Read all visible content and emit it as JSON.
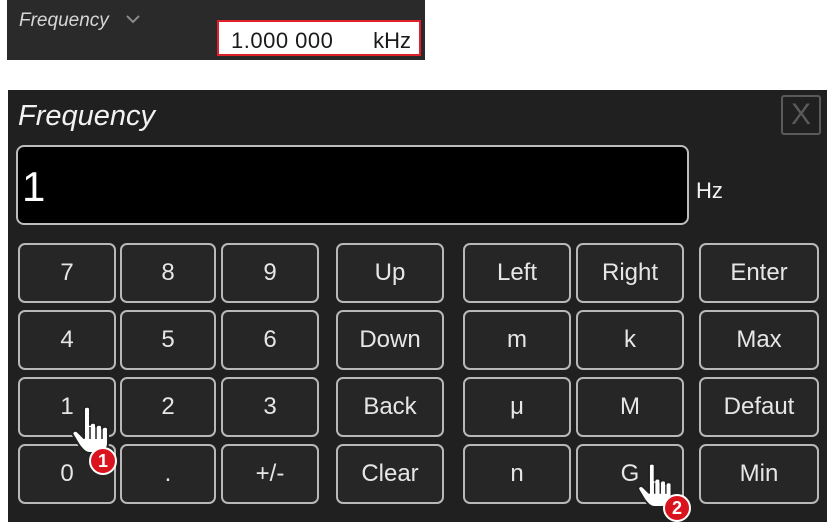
{
  "param_bar": {
    "label": "Frequency",
    "value": "1.000 000",
    "unit": "kHz",
    "icons": {
      "dropdown": "chevron-down-icon"
    }
  },
  "dialog": {
    "title": "Frequency",
    "close_label": "X",
    "entry_value": "1",
    "unit": "Hz",
    "keys": {
      "k7": "7",
      "k8": "8",
      "k9": "9",
      "k4": "4",
      "k5": "5",
      "k6": "6",
      "k1": "1",
      "k2": "2",
      "k3": "3",
      "k0": "0",
      "dot": ".",
      "sign": "+/-",
      "up": "Up",
      "down": "Down",
      "back": "Back",
      "clear": "Clear",
      "left": "Left",
      "right": "Right",
      "milli": "m",
      "kilo": "k",
      "micro": "μ",
      "mega": "M",
      "nano": "n",
      "giga": "G",
      "enter": "Enter",
      "max": "Max",
      "default": "Defaut",
      "min": "Min"
    }
  },
  "callouts": [
    {
      "number": "1"
    },
    {
      "number": "2"
    }
  ],
  "colors": {
    "highlight_border": "#e0202a",
    "badge": "#d9141e",
    "dialog_bg": "#202020",
    "key_border": "#b8b8b8"
  }
}
